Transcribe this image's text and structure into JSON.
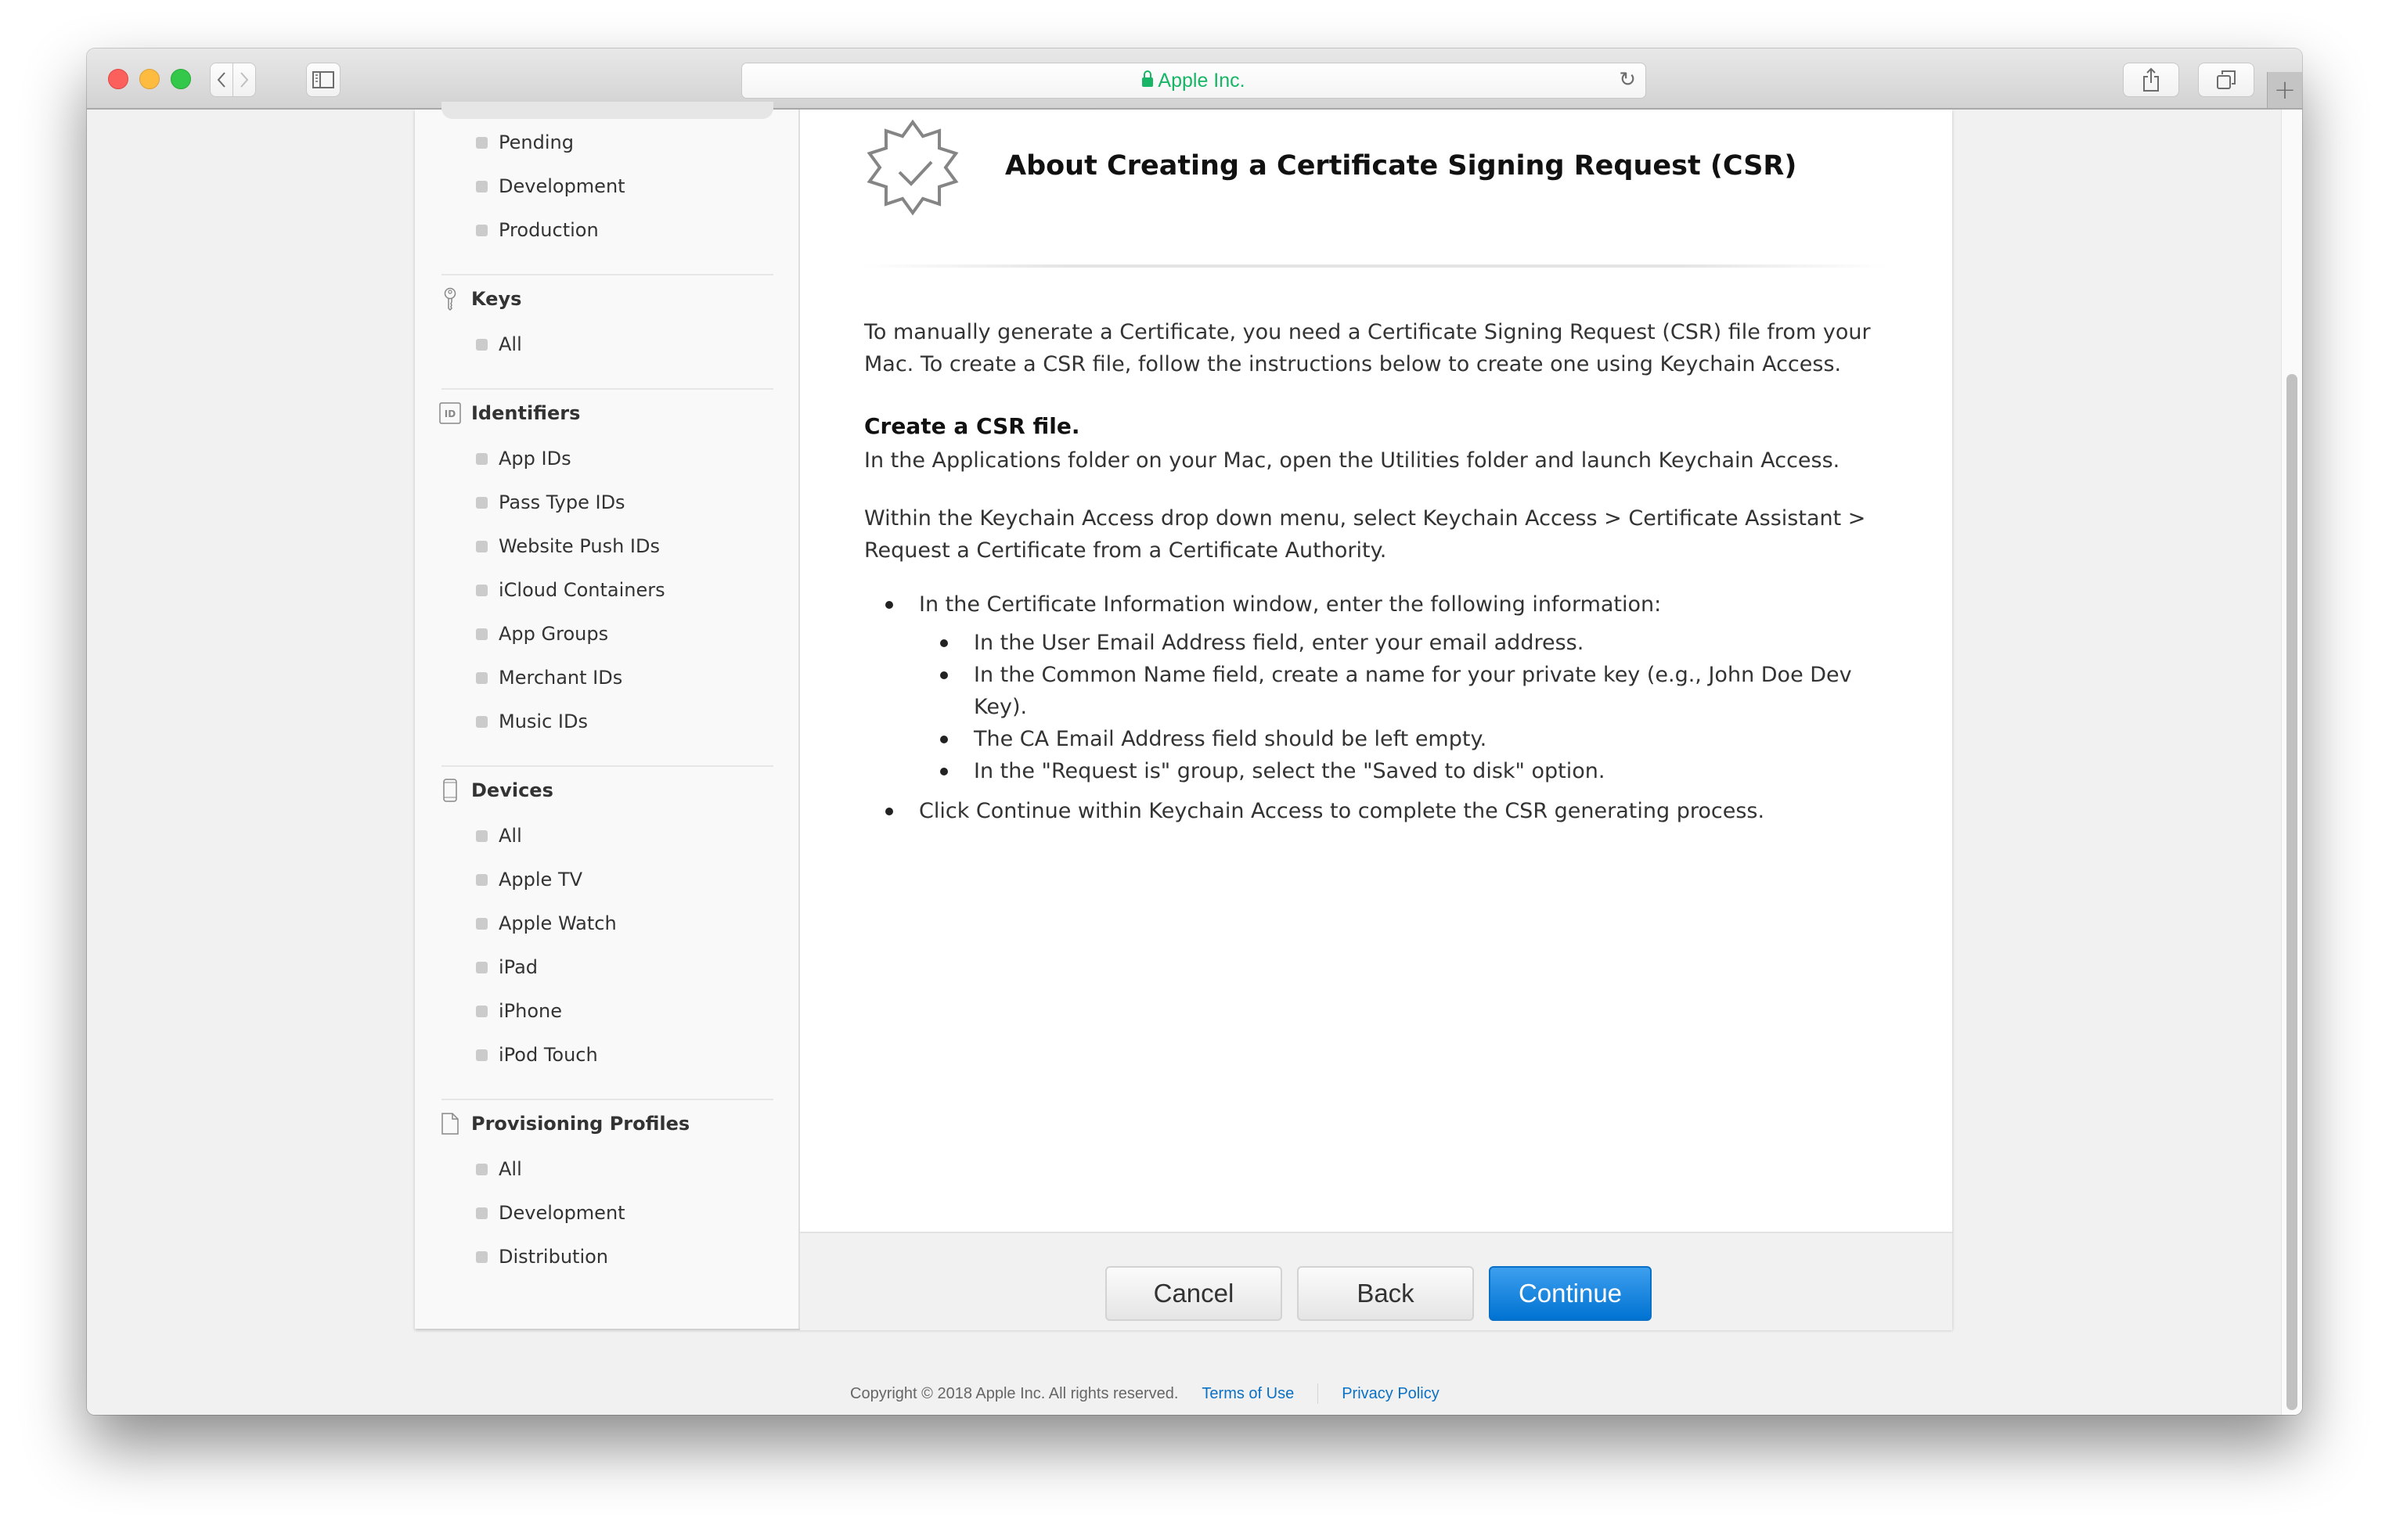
{
  "browser": {
    "url_display": "Apple Inc.",
    "secure": true,
    "accent_secure_color": "#17b565"
  },
  "sidebar": {
    "certificates_items": [
      "Pending",
      "Development",
      "Production"
    ],
    "sections": [
      {
        "title": "Keys",
        "icon": "key-icon",
        "items": [
          "All"
        ]
      },
      {
        "title": "Identifiers",
        "icon": "id-icon",
        "items": [
          "App IDs",
          "Pass Type IDs",
          "Website Push IDs",
          "iCloud Containers",
          "App Groups",
          "Merchant IDs",
          "Music IDs"
        ]
      },
      {
        "title": "Devices",
        "icon": "device-icon",
        "items": [
          "All",
          "Apple TV",
          "Apple Watch",
          "iPad",
          "iPhone",
          "iPod Touch"
        ]
      },
      {
        "title": "Provisioning Profiles",
        "icon": "document-icon",
        "items": [
          "All",
          "Development",
          "Distribution"
        ]
      }
    ]
  },
  "main": {
    "title": "About Creating a Certificate Signing Request (CSR)",
    "intro": "To manually generate a Certificate, you need a Certificate Signing Request (CSR) file from your Mac. To create a CSR file, follow the instructions below to create one using Keychain Access.",
    "subheading": "Create a CSR file.",
    "step1": "In the Applications folder on your Mac, open the Utilities folder and launch Keychain Access.",
    "step2": "Within the Keychain Access drop down menu, select Keychain Access > Certificate Assistant > Request a Certificate from a Certificate Authority.",
    "bullets": [
      {
        "text": "In the Certificate Information window, enter the following information:",
        "sub": [
          "In the User Email Address field, enter your email address.",
          "In the Common Name field, create a name for your private key (e.g., John Doe Dev Key).",
          "The CA Email Address field should be left empty.",
          "In the \"Request is\" group, select the \"Saved to disk\" option."
        ]
      },
      {
        "text": "Click Continue within Keychain Access to complete the CSR generating process.",
        "sub": []
      }
    ]
  },
  "buttons": {
    "cancel": "Cancel",
    "back": "Back",
    "continue": "Continue",
    "primary_color": "#0a78d7"
  },
  "footer": {
    "copyright": "Copyright © 2018 Apple Inc. All rights reserved.",
    "terms": "Terms of Use",
    "privacy": "Privacy Policy"
  }
}
